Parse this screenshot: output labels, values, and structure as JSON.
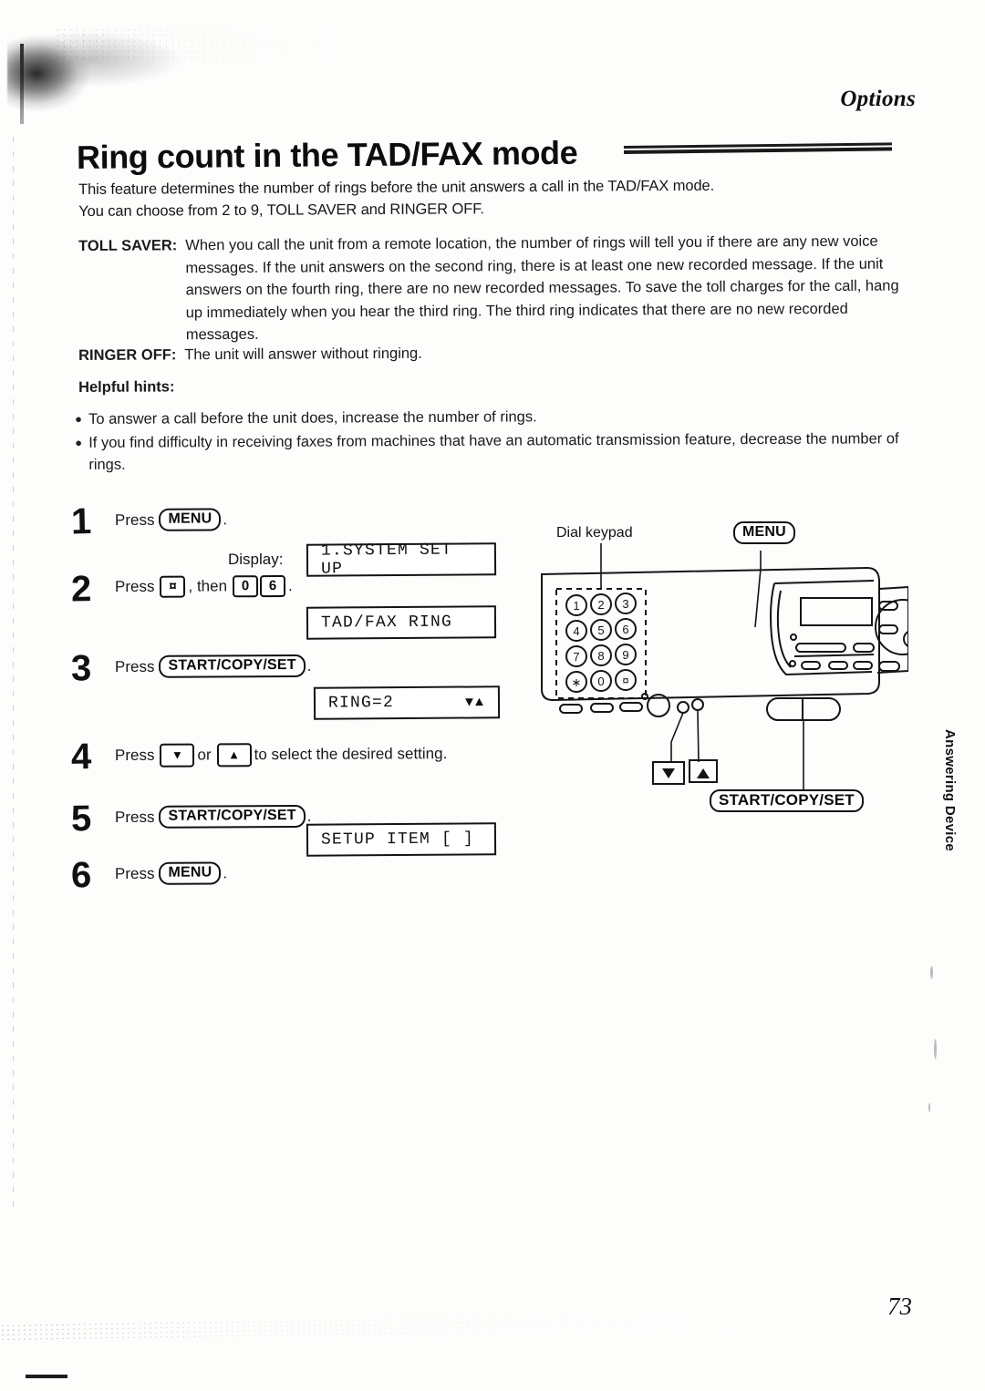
{
  "header": {
    "section_tag": "Options",
    "title": "Ring count in the TAD/FAX mode"
  },
  "intro": {
    "line1": "This feature determines the number of rings before the unit answers a call in the TAD/FAX mode.",
    "line2": "You can choose from 2 to 9, TOLL SAVER and RINGER OFF."
  },
  "definitions": [
    {
      "term": "TOLL SAVER:",
      "description": "When you call the unit from a remote location, the number of rings will tell you if there are any new voice messages. If the unit answers on the second ring, there is at least one new recorded message. If the unit answers on the fourth ring, there are no new recorded messages. To save the toll charges for the call, hang up immediately when you hear the third ring. The third ring indicates that there are no new recorded messages."
    },
    {
      "term": "RINGER OFF:",
      "description": "The unit will answer without ringing."
    }
  ],
  "hints": {
    "title": "Helpful hints:",
    "bullet_glyph": "●",
    "items": [
      "To answer a call before the unit does, increase the number of rings.",
      "If you find difficulty in receiving faxes from machines that have an automatic transmission feature, decrease the number of rings."
    ]
  },
  "steps": [
    {
      "number": "1",
      "press_label": "Press",
      "button": "MENU",
      "trailing": "."
    },
    {
      "number": "2",
      "press_label": "Press",
      "key1": "¤",
      "mid": ", then",
      "key2": "0",
      "key3": "6",
      "trailing": "."
    },
    {
      "number": "3",
      "press_label": "Press",
      "button": "START/COPY/SET",
      "trailing": "."
    },
    {
      "number": "4",
      "press_label": "Press",
      "key_down": "▼",
      "mid": "or",
      "key_up": "▲",
      "tail": "to select the desired setting."
    },
    {
      "number": "5",
      "press_label": "Press",
      "button": "START/COPY/SET",
      "trailing": "."
    },
    {
      "number": "6",
      "press_label": "Press",
      "button": "MENU",
      "trailing": "."
    }
  ],
  "display_label": "Display:",
  "displays": [
    {
      "text": "1.SYSTEM SET UP",
      "arrows": ""
    },
    {
      "text": "TAD/FAX RING",
      "arrows": ""
    },
    {
      "text": "RING=2",
      "arrows": "▼▲"
    },
    {
      "text": "SETUP ITEM [   ]",
      "arrows": ""
    }
  ],
  "figure": {
    "keypad_label": "Dial keypad",
    "menu_label": "MENU",
    "start_label": "START/COPY/SET",
    "down_arrow": "▼",
    "up_arrow": "▲",
    "keypad_keys": [
      "1",
      "2",
      "3",
      "4",
      "5",
      "6",
      "7",
      "8",
      "9",
      "∗",
      "0",
      "¤"
    ]
  },
  "side_tab": "Answering Device",
  "folio": "73"
}
